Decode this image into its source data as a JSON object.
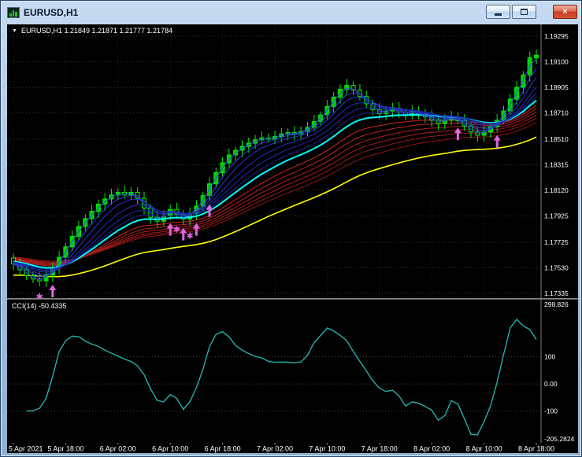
{
  "window": {
    "title": "EURUSD,H1"
  },
  "chart_data": {
    "type": "candlestick+oscillator",
    "title": "EURUSD,H1",
    "symbol": "EURUSD",
    "timeframe": "H1",
    "overlay_text": "EURUSD,H1  1.21849 1.21871 1.21777 1.21784",
    "price_axis": {
      "labels": [
        "1.19295",
        "1.19100",
        "1.18905",
        "1.18710",
        "1.18510",
        "1.18315",
        "1.18120",
        "1.17925",
        "1.17725",
        "1.17530",
        "1.17335"
      ],
      "values": [
        1.19295,
        1.191,
        1.18905,
        1.1871,
        1.1851,
        1.18315,
        1.1812,
        1.17925,
        1.17725,
        1.1753,
        1.17335
      ],
      "max": 1.19295,
      "min": 1.17335
    },
    "time_axis": [
      {
        "bar": 0,
        "label": "5 Apr 2021"
      },
      {
        "bar": 8,
        "label": "5 Apr 18:00"
      },
      {
        "bar": 16,
        "label": "6 Apr 02:00"
      },
      {
        "bar": 24,
        "label": "6 Apr 10:00"
      },
      {
        "bar": 32,
        "label": "6 Apr 18:00"
      },
      {
        "bar": 40,
        "label": "7 Apr 02:00"
      },
      {
        "bar": 48,
        "label": "7 Apr 10:00"
      },
      {
        "bar": 56,
        "label": "7 Apr 18:00"
      },
      {
        "bar": 64,
        "label": "8 Apr 02:00"
      },
      {
        "bar": 72,
        "label": "8 Apr 10:00"
      },
      {
        "bar": 80,
        "label": "8 Apr 18:00"
      }
    ],
    "close": [
      1.1756,
      1.17515,
      1.1747,
      1.17445,
      1.1743,
      1.17475,
      1.1753,
      1.1761,
      1.1769,
      1.1777,
      1.17845,
      1.17905,
      1.1796,
      1.18015,
      1.18055,
      1.18085,
      1.18105,
      1.18085,
      1.18105,
      1.1806,
      1.17985,
      1.17915,
      1.17885,
      1.17925,
      1.17975,
      1.17935,
      1.179,
      1.17945,
      1.18,
      1.1808,
      1.1817,
      1.18255,
      1.1833,
      1.1839,
      1.18425,
      1.18455,
      1.1848,
      1.18505,
      1.1852,
      1.1851,
      1.1853,
      1.1855,
      1.1856,
      1.1855,
      1.1857,
      1.186,
      1.18645,
      1.18695,
      1.1876,
      1.1883,
      1.1889,
      1.1892,
      1.18885,
      1.18835,
      1.1878,
      1.18735,
      1.18705,
      1.18725,
      1.18745,
      1.18715,
      1.1869,
      1.1872,
      1.187,
      1.1868,
      1.18655,
      1.1863,
      1.18655,
      1.1868,
      1.1865,
      1.1861,
      1.18565,
      1.1854,
      1.18565,
      1.18605,
      1.18655,
      1.18725,
      1.18815,
      1.18905,
      1.19,
      1.1913,
      1.1915
    ],
    "signals": [
      {
        "bar": 4,
        "type": "star"
      },
      {
        "bar": 6,
        "type": "up-arrow"
      },
      {
        "bar": 24,
        "type": "up-arrow"
      },
      {
        "bar": 25,
        "type": "star"
      },
      {
        "bar": 26,
        "type": "up-arrow"
      },
      {
        "bar": 27,
        "type": "star"
      },
      {
        "bar": 28,
        "type": "up-arrow"
      },
      {
        "bar": 30,
        "type": "up-arrow"
      },
      {
        "bar": 68,
        "type": "up-arrow"
      },
      {
        "bar": 74,
        "type": "up-arrow"
      }
    ],
    "moving_averages": {
      "blue_ribbon_periods": [
        2,
        4,
        6,
        9,
        12,
        15
      ],
      "red_ribbon_periods": [
        24,
        28,
        32,
        36,
        40,
        45
      ],
      "cyan_period": 18,
      "yellow_period": 50
    },
    "cci": {
      "label": "CCI(14) -50.4335",
      "period": 14,
      "axis_labels": [
        "298.826",
        "100",
        "0.00",
        "-100",
        "-205.2824"
      ],
      "axis_values": [
        298.826,
        100,
        0,
        -100,
        -205.2824
      ],
      "levels": [
        100,
        0,
        -100
      ],
      "max": 298.826,
      "min": -205.2824
    },
    "colors": {
      "background": "#000000",
      "candle_bull": "#00CC00",
      "candle_outline": "#00F000",
      "grid": "#3a3a3a",
      "blue_ribbon": [
        "#3346ee",
        "#2d3ee0",
        "#2837d2",
        "#2330c4",
        "#1e29b6",
        "#1922a8"
      ],
      "red_ribbon": [
        "#cc2626",
        "#c02222",
        "#b41f1f",
        "#a81c1c",
        "#9c1919",
        "#8f1616"
      ],
      "cyan_line": "#00FFFF",
      "yellow_line": "#FFFF00",
      "signal": "#E066E0",
      "cci_line": "#20B2AA",
      "axis_text": "#FFFFFF"
    }
  }
}
